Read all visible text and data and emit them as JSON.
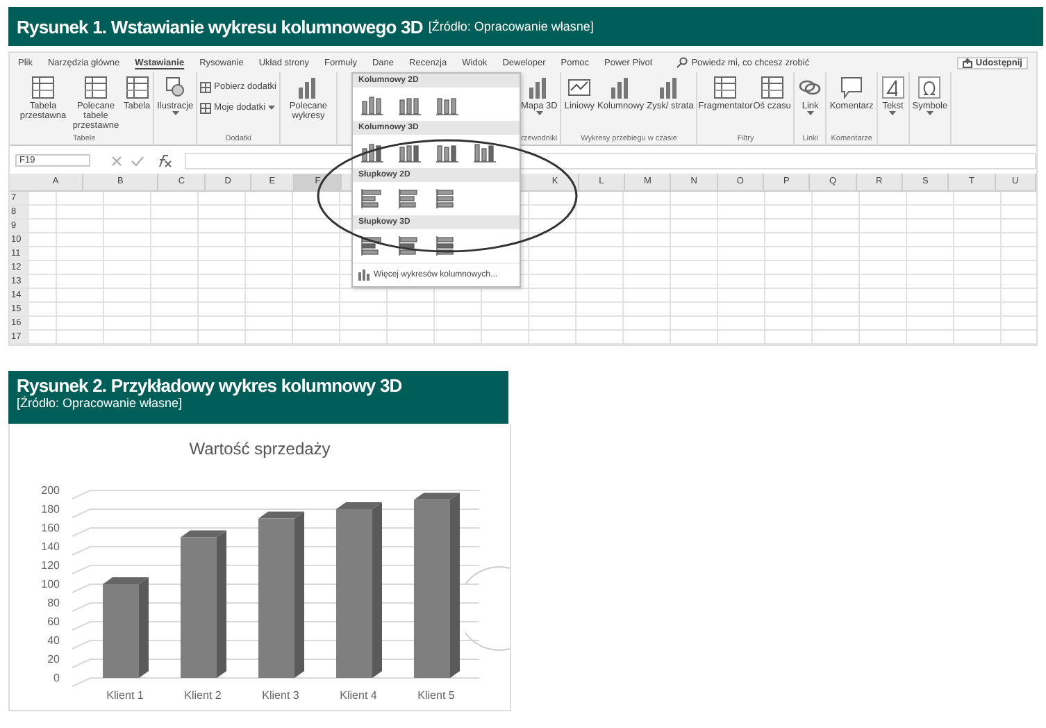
{
  "figure_1": {
    "caption": "Rysunek 1. Wstawianie wykresu kolumnowego 3D",
    "source": "[Źródło: Opracowanie własne]",
    "excel": {
      "menu_tabs": [
        {
          "label": "Plik",
          "selected": false
        },
        {
          "label": "Narzędzia główne",
          "selected": false
        },
        {
          "label": "Wstawianie",
          "selected": true
        },
        {
          "label": "Rysowanie",
          "selected": false
        },
        {
          "label": "Układ strony",
          "selected": false
        },
        {
          "label": "Formuły",
          "selected": false
        },
        {
          "label": "Dane",
          "selected": false
        },
        {
          "label": "Recenzja",
          "selected": false
        },
        {
          "label": "Widok",
          "selected": false
        },
        {
          "label": "Deweloper",
          "selected": false
        },
        {
          "label": "Pomoc",
          "selected": false
        },
        {
          "label": "Power Pivot",
          "selected": false
        }
      ],
      "search": {
        "placeholder": "Powiedz mi, co chcesz zrobić"
      },
      "share_button": "Udostępnij",
      "ribbon_groups": [
        {
          "label": "Tabele",
          "buttons": [
            {
              "kind": "large",
              "label": "Tabela przestawna",
              "menu": false
            },
            {
              "kind": "large",
              "label": "Polecane tabele przestawne",
              "menu": false
            },
            {
              "kind": "large",
              "label": "Tabela",
              "menu": false
            }
          ]
        },
        {
          "buttons": [
            {
              "kind": "large",
              "label": "Ilustracje",
              "menu": true
            }
          ]
        },
        {
          "label": "Dodatki",
          "buttons": [
            {
              "kind": "small",
              "label": "Pobierz dodatki",
              "menu": false
            },
            {
              "kind": "small",
              "label": "Moje dodatki",
              "menu": true
            }
          ]
        },
        {
          "buttons": [
            {
              "kind": "large",
              "label": "Polecane wykresy",
              "menu": false
            }
          ]
        },
        {
          "label": "rzewodniki",
          "buttons": [
            {
              "kind": "large",
              "label": "Mapa 3D",
              "menu": true
            }
          ]
        },
        {
          "label": "Wykresy przebiegu w czasie",
          "buttons": [
            {
              "kind": "large",
              "label": "Liniowy",
              "menu": false
            },
            {
              "kind": "large",
              "label": "Kolumnowy",
              "menu": false
            },
            {
              "kind": "large",
              "label": "Zysk/ strata",
              "menu": false
            }
          ]
        },
        {
          "label": "Filtry",
          "buttons": [
            {
              "kind": "large",
              "label": "Fragmentator",
              "menu": false
            },
            {
              "kind": "large",
              "label": "Oś czasu",
              "menu": false
            }
          ]
        },
        {
          "label": "Linki",
          "buttons": [
            {
              "kind": "large",
              "label": "Link",
              "menu": true
            }
          ]
        },
        {
          "label": "Komentarze",
          "buttons": [
            {
              "kind": "large",
              "label": "Komentarz",
              "menu": false
            }
          ]
        },
        {
          "buttons": [
            {
              "kind": "large",
              "label": "Tekst",
              "menu": true
            }
          ]
        },
        {
          "buttons": [
            {
              "kind": "large",
              "label": "Symbole",
              "menu": true
            }
          ]
        }
      ],
      "name_box": "F19",
      "columns": [
        {
          "label": "A",
          "selected": false
        },
        {
          "label": "B",
          "selected": false
        },
        {
          "label": "C",
          "selected": false
        },
        {
          "label": "D",
          "selected": false
        },
        {
          "label": "E",
          "selected": false
        },
        {
          "label": "F",
          "selected": true
        },
        {
          "label": "K",
          "selected": false
        },
        {
          "label": "L",
          "selected": false
        },
        {
          "label": "M",
          "selected": false
        },
        {
          "label": "N",
          "selected": false
        },
        {
          "label": "O",
          "selected": false
        },
        {
          "label": "P",
          "selected": false
        },
        {
          "label": "Q",
          "selected": false
        },
        {
          "label": "R",
          "selected": false
        },
        {
          "label": "S",
          "selected": false
        },
        {
          "label": "T",
          "selected": false
        },
        {
          "label": "U",
          "selected": false
        }
      ],
      "rows": [
        "7",
        "8",
        "9",
        "10",
        "11",
        "12",
        "13",
        "14",
        "15",
        "16",
        "17"
      ],
      "chart_menu": {
        "sections": [
          {
            "kind": "column",
            "title": "Kolumnowy 2D"
          },
          {
            "kind": "column3d",
            "title": "Kolumnowy 3D"
          },
          {
            "kind": "bar",
            "title": "Słupkowy 2D"
          },
          {
            "kind": "bar3d",
            "title": "Słupkowy 3D"
          }
        ],
        "more_link": "Więcej wykresów kolumnowych..."
      }
    }
  },
  "figure_2": {
    "caption": "Rysunek 2. Przykładowy wykres kolumnowy 3D",
    "source": "[Źródło: Opracowanie własne]",
    "chart_data": {
      "type": "bar",
      "title": "Wartość sprzedaży",
      "categories": [
        "Klient 1",
        "Klient 2",
        "Klient 3",
        "Klient 4",
        "Klient 5"
      ],
      "series": [
        {
          "color": "#7f7f7f",
          "values": [
            100,
            150,
            170,
            180,
            190
          ]
        }
      ],
      "ylim": [
        0,
        200
      ],
      "yticks": [
        0,
        20,
        40,
        60,
        80,
        100,
        120,
        140,
        160,
        180,
        200
      ]
    }
  }
}
